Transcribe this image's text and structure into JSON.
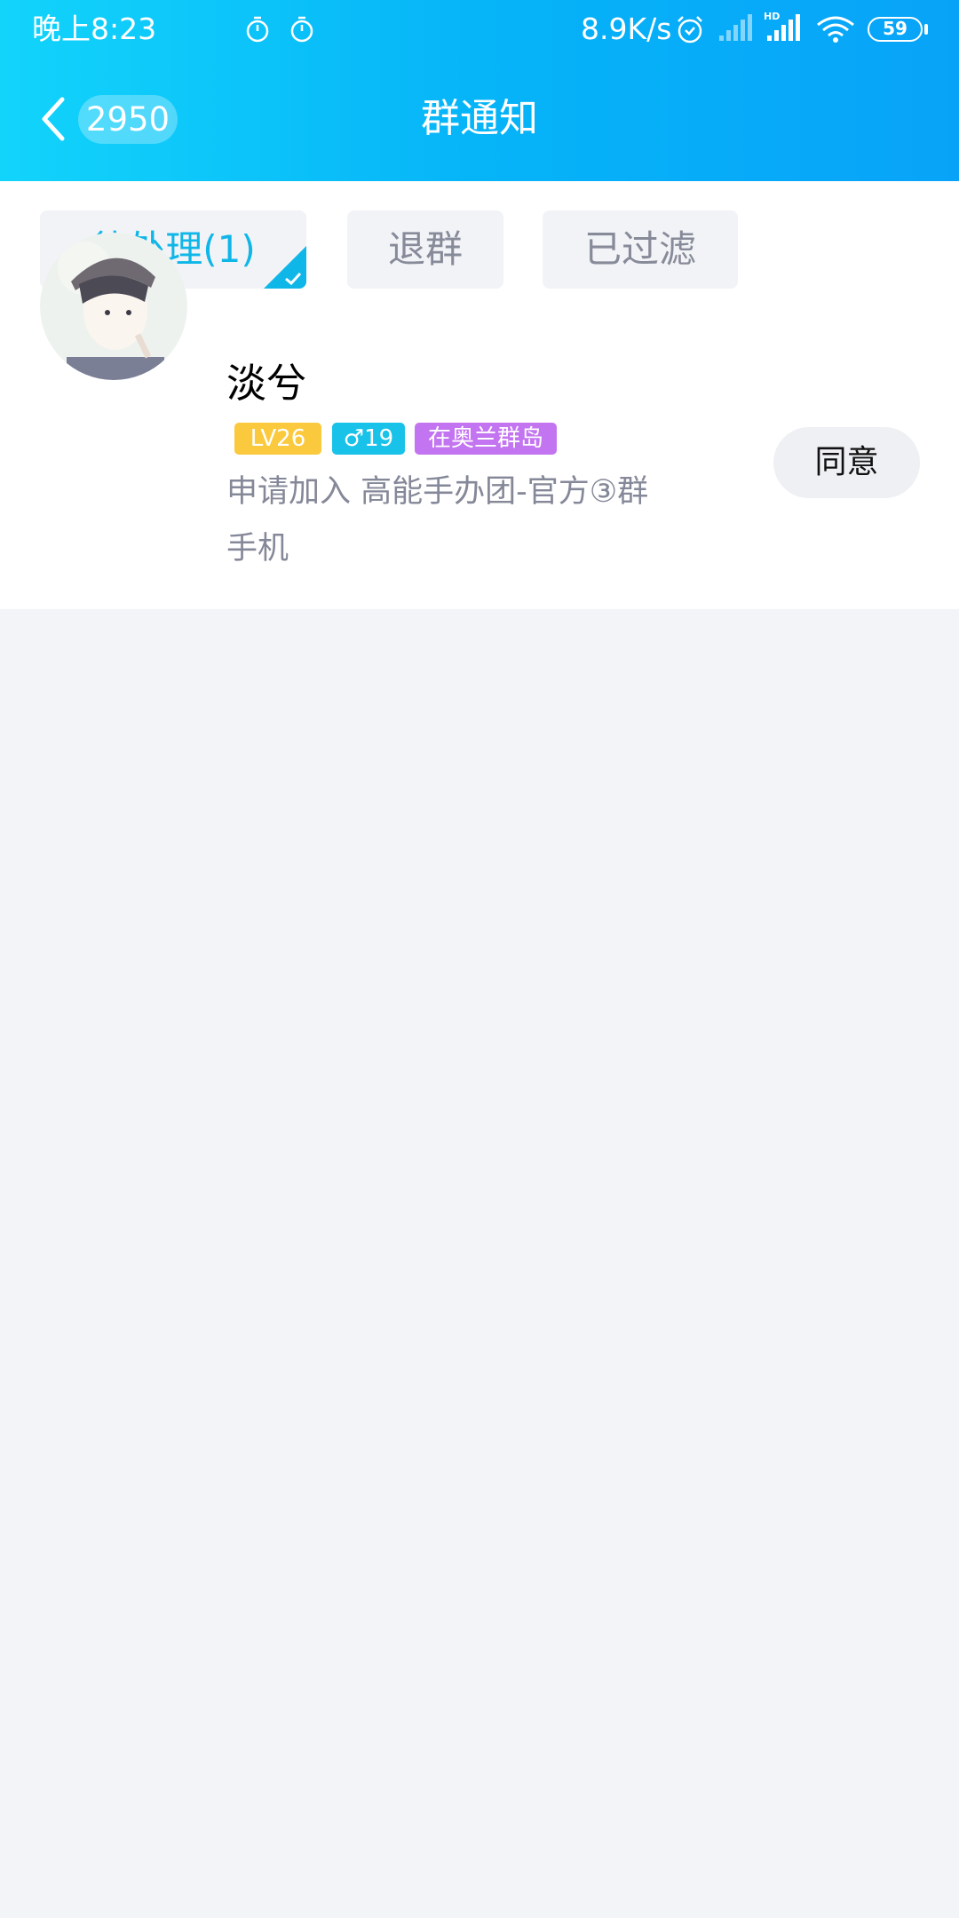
{
  "status_bar": {
    "time": "晚上8:23",
    "net_speed": "8.9K/s",
    "battery": "59",
    "icons": [
      "timer-icon",
      "timer-icon",
      "alarm-icon",
      "signal-icon",
      "signal-hd-icon",
      "wifi-icon",
      "battery-icon"
    ]
  },
  "nav": {
    "back_icon": "chevron-left-icon",
    "unread_count": "2950",
    "title": "群通知"
  },
  "tabs": [
    {
      "label": "待处理(1)",
      "active": true
    },
    {
      "label": "退群",
      "active": false
    },
    {
      "label": "已过滤",
      "active": false
    }
  ],
  "notifications": [
    {
      "name": "淡兮",
      "badges": {
        "level": "LV26",
        "gender_age": "♂19",
        "location": "在奥兰群岛"
      },
      "message": "申请加入 高能手办团-官方③群",
      "message_cont": "手机",
      "action": "同意"
    }
  ],
  "colors": {
    "header_start": "#12d4fb",
    "header_end": "#08a3f8",
    "accent": "#0fb6e8",
    "badge_level": "#fbc93d",
    "badge_gender": "#19c2e8",
    "badge_location": "#c374f0",
    "background": "#f3f4f8"
  }
}
